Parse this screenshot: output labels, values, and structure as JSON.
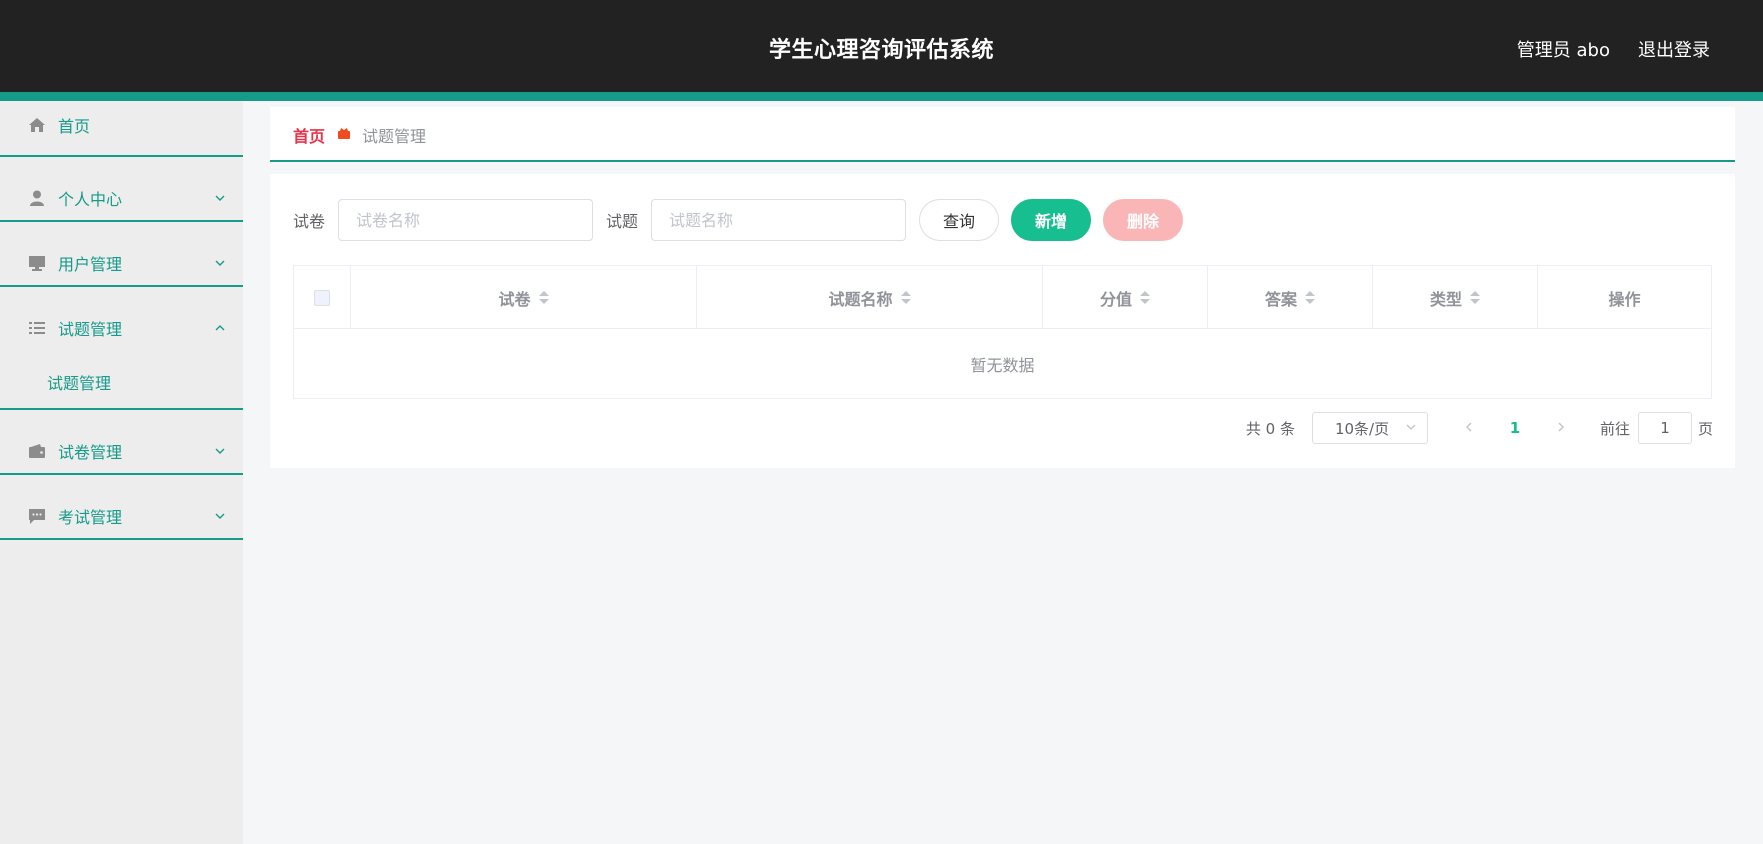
{
  "header": {
    "title": "学生心理咨询评估系统",
    "user": "管理员 abo",
    "logout": "退出登录"
  },
  "sidebar": {
    "items": [
      {
        "label": "首页",
        "icon": "home-icon"
      },
      {
        "label": "个人中心",
        "icon": "user-icon"
      },
      {
        "label": "用户管理",
        "icon": "monitor-icon"
      },
      {
        "label": "试题管理",
        "icon": "list-icon",
        "submenu": [
          "试题管理"
        ]
      },
      {
        "label": "试卷管理",
        "icon": "wallet-icon"
      },
      {
        "label": "考试管理",
        "icon": "chat-icon"
      }
    ]
  },
  "breadcrumb": {
    "home": "首页",
    "current": "试题管理"
  },
  "search": {
    "paper_label": "试卷",
    "paper_placeholder": "试卷名称",
    "question_label": "试题",
    "question_placeholder": "试题名称",
    "query": "查询",
    "add": "新增",
    "delete": "删除"
  },
  "table": {
    "columns": [
      "试卷",
      "试题名称",
      "分值",
      "答案",
      "类型",
      "操作"
    ],
    "empty": "暂无数据"
  },
  "pagination": {
    "total": "共 0 条",
    "page_size": "10条/页",
    "current_page": "1",
    "goto": "前往",
    "goto_value": "1",
    "page_unit": "页"
  },
  "colors": {
    "accent": "#169a89",
    "primary": "#17be8f",
    "danger_light": "#fab6b6",
    "breadcrumb_home": "#e8334a",
    "header_bg": "#222222"
  }
}
